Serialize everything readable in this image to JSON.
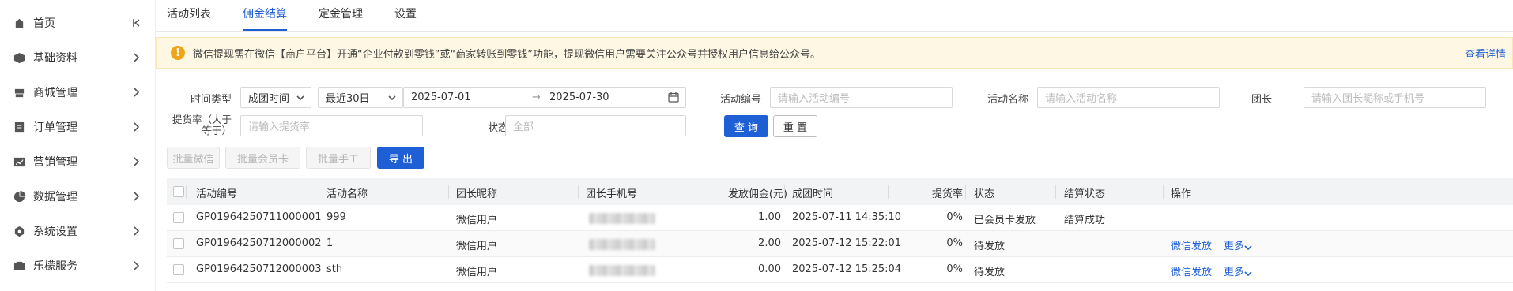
{
  "sidebar": {
    "items": [
      {
        "label": "首页",
        "icon": "home-icon"
      },
      {
        "label": "基础资料",
        "icon": "cube-icon"
      },
      {
        "label": "商城管理",
        "icon": "shop-icon"
      },
      {
        "label": "订单管理",
        "icon": "order-icon"
      },
      {
        "label": "营销管理",
        "icon": "chart-icon"
      },
      {
        "label": "数据管理",
        "icon": "pie-icon"
      },
      {
        "label": "系统设置",
        "icon": "settings-icon"
      },
      {
        "label": "乐檬服务",
        "icon": "service-icon"
      }
    ]
  },
  "tabs": [
    {
      "label": "活动列表"
    },
    {
      "label": "佣金结算"
    },
    {
      "label": "定金管理"
    },
    {
      "label": "设置"
    }
  ],
  "notice": {
    "text": "微信提现需在微信【商户平台】开通“企业付款到零钱”或“商家转账到零钱”功能，提现微信用户需要关注公众号并授权用户信息给公众号。",
    "link": "查看详情"
  },
  "filters": {
    "time_type_label": "时间类型",
    "time_type_value": "成团时间",
    "range_value": "最近30日",
    "date_start": "2025-07-01",
    "date_arrow": "→",
    "date_end": "2025-07-30",
    "activity_no_label": "活动编号",
    "activity_no_placeholder": "请输入活动编号",
    "activity_name_label": "活动名称",
    "activity_name_placeholder": "请输入活动名称",
    "leader_label": "团长",
    "leader_placeholder": "请输入团长昵称或手机号",
    "rate_label_line1": "提货率（大于",
    "rate_label_line2": "等于）",
    "rate_placeholder": "请输入提货率",
    "status_label": "状态",
    "status_value": "全部",
    "query_button": "查 询",
    "reset_button": "重 置"
  },
  "actions": {
    "batch_wechat": "批量微信",
    "batch_card": "批量会员卡",
    "batch_manual": "批量手工",
    "export": "导 出"
  },
  "table": {
    "headers": {
      "activity_no": "活动编号",
      "activity_name": "活动名称",
      "leader_nick": "团长昵称",
      "leader_phone": "团长手机号",
      "commission": "发放佣金(元)",
      "group_time": "成团时间",
      "pickup_rate": "提货率",
      "status": "状态",
      "settle_status": "结算状态",
      "ops": "操作"
    },
    "rows": [
      {
        "activity_no": "GP01964250711000001",
        "activity_name": "999",
        "leader_nick": "微信用户",
        "commission": "1.00",
        "group_time": "2025-07-11 14:35:10",
        "pickup_rate": "0%",
        "status": "已会员卡发放",
        "settle_status": "结算成功",
        "op1": "",
        "op2": ""
      },
      {
        "activity_no": "GP01964250712000002",
        "activity_name": "1",
        "leader_nick": "微信用户",
        "commission": "2.00",
        "group_time": "2025-07-12 15:22:01",
        "pickup_rate": "0%",
        "status": "待发放",
        "settle_status": "",
        "op1": "微信发放",
        "op2": "更多"
      },
      {
        "activity_no": "GP01964250712000003",
        "activity_name": "sth",
        "leader_nick": "微信用户",
        "commission": "0.00",
        "group_time": "2025-07-12 15:25:04",
        "pickup_rate": "0%",
        "status": "待发放",
        "settle_status": "",
        "op1": "微信发放",
        "op2": "更多"
      }
    ]
  },
  "colors": {
    "primary": "#1f5fd6",
    "notice_bg": "#fdf7e3",
    "warn": "#f0a418"
  }
}
